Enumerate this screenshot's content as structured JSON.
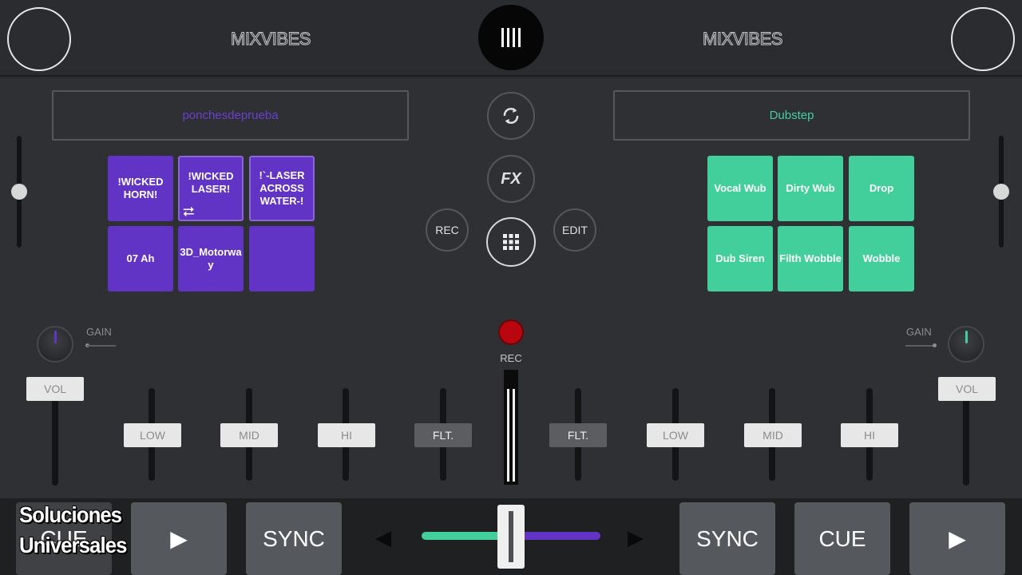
{
  "header": {
    "brand_left": "MIXVIBES",
    "brand_right": "MIXVIBES"
  },
  "deck_a": {
    "pack_name": "ponchesdeprueba",
    "pack_color": "#6a3fd0",
    "pads": [
      "!WICKED HORN!",
      "!WICKED LASER!",
      "!`-LASER ACROSS WATER-!",
      "07 Ah",
      "3D_Motorwa y",
      ""
    ],
    "gain_label": "GAIN",
    "vol_label": "VOL",
    "eq": {
      "low": "LOW",
      "mid": "MID",
      "hi": "HI",
      "filter": "FLT."
    }
  },
  "deck_b": {
    "pack_name": "Dubstep",
    "pack_color": "#42cf9b",
    "pads": [
      "Vocal Wub",
      "Dirty Wub",
      "Drop",
      "Dub Siren",
      "Filth Wobble",
      "Wobble"
    ],
    "gain_label": "GAIN",
    "vol_label": "VOL",
    "eq": {
      "low": "LOW",
      "mid": "MID",
      "hi": "HI",
      "filter": "FLT."
    }
  },
  "center": {
    "fx_label": "FX",
    "rec_button_label": "REC",
    "edit_button_label": "EDIT",
    "record_label": "REC"
  },
  "transport": {
    "left": {
      "cue": "CUE",
      "play": "▶",
      "sync": "SYNC"
    },
    "right": {
      "sync": "SYNC",
      "cue": "CUE",
      "play": "▶"
    },
    "arrow_left": "◀",
    "arrow_right": "▶"
  },
  "colors": {
    "accent_purple": "#6234c6",
    "accent_green": "#42cf9b",
    "record_red": "#b8060f"
  },
  "watermark": {
    "line1": "Soluciones",
    "line2": "Universales"
  }
}
